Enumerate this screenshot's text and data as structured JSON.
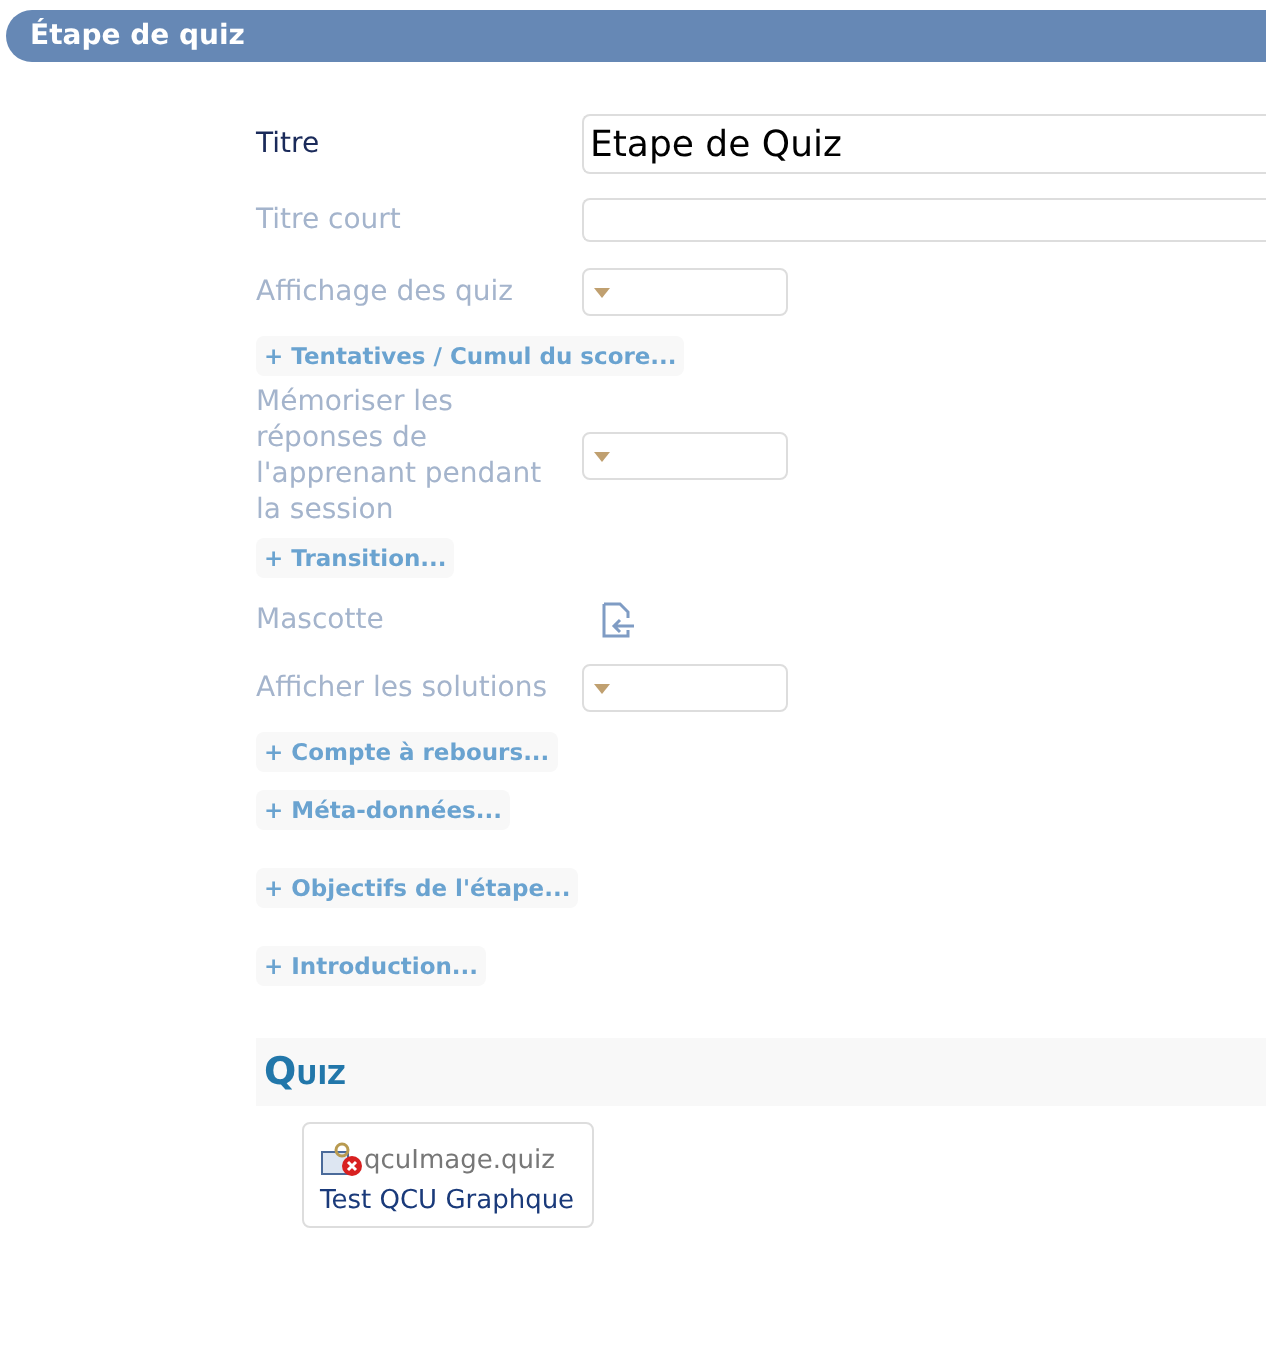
{
  "header": {
    "title": "Étape de quiz"
  },
  "rows": [
    {
      "kind": "text",
      "label": "Titre",
      "required": true,
      "value": "Etape de Quiz"
    },
    {
      "kind": "text",
      "label": "Titre court",
      "required": false
    },
    {
      "kind": "select",
      "label": "Affichage des quiz",
      "required": false
    },
    {
      "kind": "link",
      "label": "+ Tentatives / Cumul du score..."
    },
    {
      "kind": "select",
      "label": "Mémoriser les réponses de l'apprenant pendant la session",
      "required": false
    },
    {
      "kind": "link",
      "label": "+ Transition..."
    },
    {
      "kind": "file",
      "label": "Mascotte",
      "required": false
    },
    {
      "kind": "select",
      "label": "Afficher les solutions",
      "required": false
    },
    {
      "kind": "link",
      "label": "+ Compte à rebours..."
    },
    {
      "kind": "link",
      "label": "+ Méta-données..."
    },
    {
      "kind": "link",
      "label": "+ Objectifs de l'étape..."
    },
    {
      "kind": "link",
      "label": "+ Introduction..."
    }
  ],
  "quiz": {
    "title": "Quiz",
    "items": [
      {
        "file": "qcuImage.quiz",
        "name": "Test QCU Graphque"
      }
    ]
  }
}
